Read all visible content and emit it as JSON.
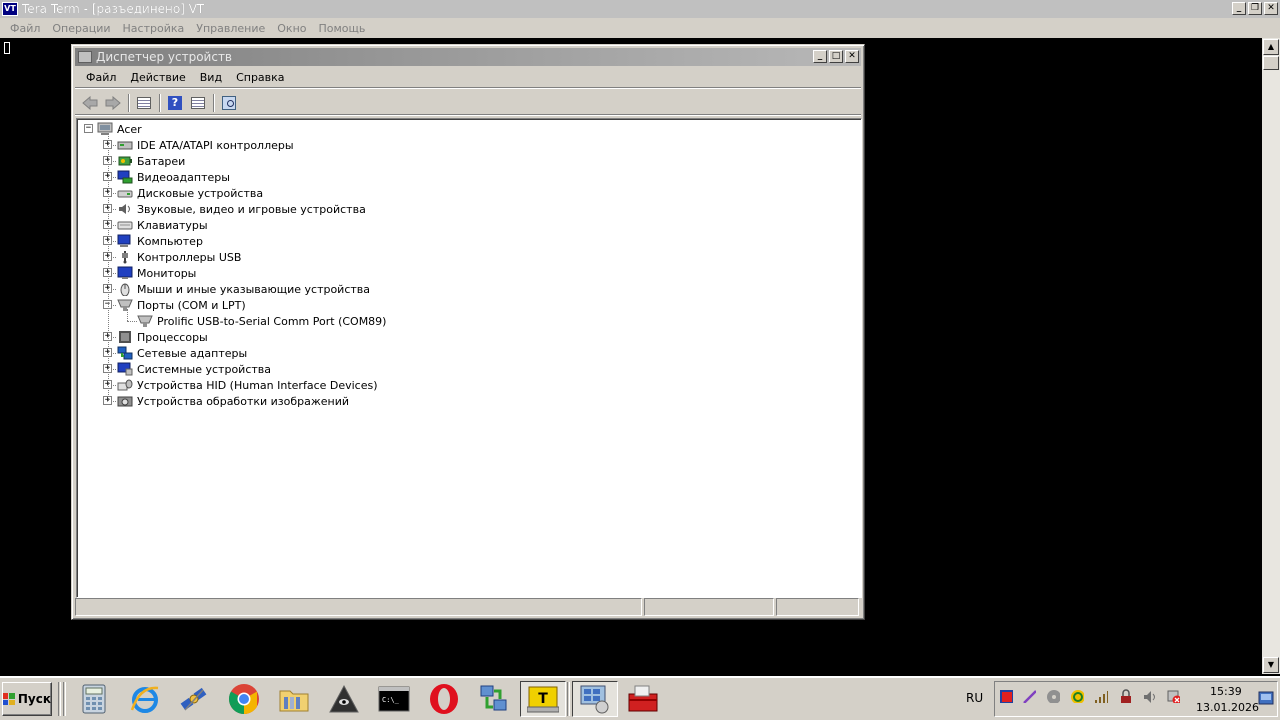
{
  "teraterm": {
    "title": "Tera Term - [разъединено] VT",
    "icon_text": "VT",
    "menu": [
      "Файл",
      "Операции",
      "Настройка",
      "Управление",
      "Окно",
      "Помощь"
    ],
    "window_buttons": {
      "minimize": "_",
      "maximize": "❐",
      "close": "✕"
    }
  },
  "devmgr": {
    "title": "Диспетчер устройств",
    "menu": [
      "Файл",
      "Действие",
      "Вид",
      "Справка"
    ],
    "toolbar": [
      "back-icon",
      "forward-icon",
      "properties-icon",
      "help-icon",
      "view-icon",
      "scan-hardware-icon"
    ],
    "tree": {
      "root": "Acer",
      "expander_collapsed": "+",
      "expander_expanded": "−",
      "categories": [
        {
          "label": "IDE ATA/ATAPI контроллеры",
          "icon": "ide-icon",
          "expanded": false
        },
        {
          "label": "Батареи",
          "icon": "battery-icon",
          "expanded": false
        },
        {
          "label": "Видеоадаптеры",
          "icon": "display-adapter-icon",
          "expanded": false
        },
        {
          "label": "Дисковые устройства",
          "icon": "disk-icon",
          "expanded": false
        },
        {
          "label": "Звуковые, видео и игровые устройства",
          "icon": "sound-icon",
          "expanded": false
        },
        {
          "label": "Клавиатуры",
          "icon": "keyboard-icon",
          "expanded": false
        },
        {
          "label": "Компьютер",
          "icon": "computer-icon",
          "expanded": false
        },
        {
          "label": "Контроллеры USB",
          "icon": "usb-icon",
          "expanded": false
        },
        {
          "label": "Мониторы",
          "icon": "monitor-icon",
          "expanded": false
        },
        {
          "label": "Мыши и иные указывающие устройства",
          "icon": "mouse-icon",
          "expanded": false
        },
        {
          "label": "Порты (COM и LPT)",
          "icon": "port-icon",
          "expanded": true,
          "children": [
            {
              "label": "Prolific USB-to-Serial Comm Port (COM89)",
              "icon": "port-icon"
            }
          ]
        },
        {
          "label": "Процессоры",
          "icon": "processor-icon",
          "expanded": false
        },
        {
          "label": "Сетевые адаптеры",
          "icon": "network-icon",
          "expanded": false
        },
        {
          "label": "Системные устройства",
          "icon": "system-icon",
          "expanded": false
        },
        {
          "label": "Устройства HID (Human Interface Devices)",
          "icon": "hid-icon",
          "expanded": false
        },
        {
          "label": "Устройства обработки изображений",
          "icon": "imaging-icon",
          "expanded": false
        }
      ]
    }
  },
  "taskbar": {
    "start_label": "Пуск",
    "apps": [
      "calculator-icon",
      "internet-explorer-icon",
      "satellite-icon",
      "chrome-icon",
      "folder-icon",
      "eye-pyramid-icon",
      "cmd-icon",
      "opera-icon",
      "network-transfer-icon",
      "teraterm-icon",
      "device-manager-icon",
      "toolbox-icon"
    ],
    "active_apps": [
      "teraterm-icon",
      "device-manager-icon"
    ],
    "cmd_text": "C:\\_",
    "teraterm_letter": "T",
    "language": "RU",
    "tray_icons": [
      "stop-icon",
      "pen-icon",
      "disc-icon",
      "update-icon",
      "signal-icon",
      "lock-icon",
      "volume-icon",
      "network-error-icon"
    ],
    "time": "15:39",
    "date": "13.01.2026"
  },
  "colors": {
    "titlebar_inactive": "#808080",
    "face": "#d4d0c8",
    "terminal_bg": "#000000"
  }
}
